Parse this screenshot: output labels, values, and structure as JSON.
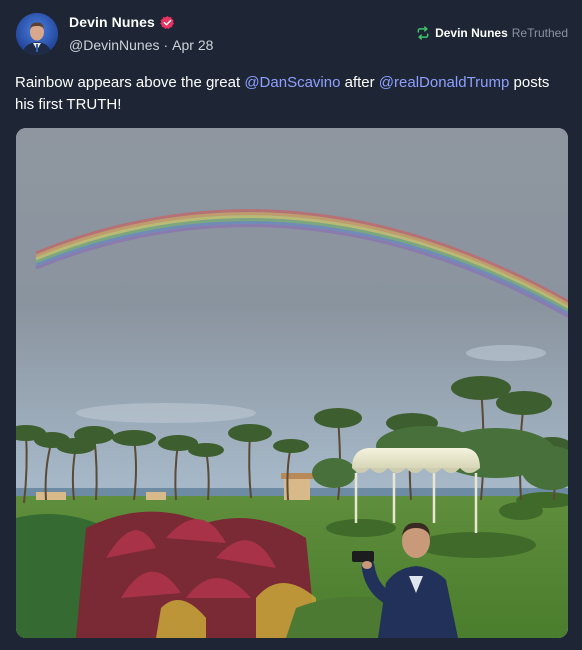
{
  "author": {
    "name": "Devin Nunes",
    "handle": "@DevinNunes",
    "separator": "·",
    "date": "Apr 28",
    "verified_icon": "verified-badge-icon",
    "verified_color": "#e8325f"
  },
  "retruth": {
    "icon": "retruth-icon",
    "icon_color": "#3fc26a",
    "user": "Devin Nunes",
    "label": "ReTruthed"
  },
  "post": {
    "text_1": "Rainbow appears above the great ",
    "mention_1": "@DanScavino",
    "text_2": " after ",
    "mention_2": "@realDonaldTrump",
    "text_3": " posts his first TRUTH!"
  },
  "colors": {
    "background": "#1e2635",
    "mention": "#8da0ff"
  }
}
